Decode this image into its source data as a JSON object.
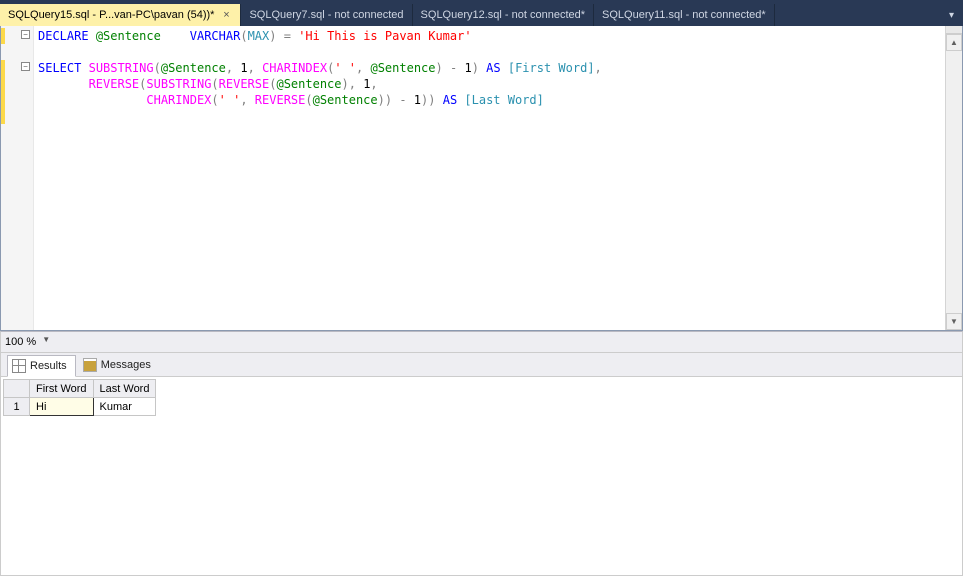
{
  "tabs": [
    {
      "label": "SQLQuery15.sql - P...van-PC\\pavan (54))*",
      "active": true,
      "closeable": true
    },
    {
      "label": "SQLQuery7.sql - not connected",
      "active": false,
      "closeable": false
    },
    {
      "label": "SQLQuery12.sql - not connected*",
      "active": false,
      "closeable": false
    },
    {
      "label": "SQLQuery11.sql - not connected*",
      "active": false,
      "closeable": false
    }
  ],
  "zoom": {
    "value": "100 %"
  },
  "code": {
    "l1": {
      "declare": "DECLARE",
      "var": "@Sentence",
      "type_kw": "VARCHAR",
      "type_arg": "MAX",
      "eq": "=",
      "str": "'Hi This is Pavan Kumar'"
    },
    "l3": {
      "select": "SELECT",
      "sub": "SUBSTRING",
      "var": "@Sentence",
      "c1": "1",
      "chi": "CHARINDEX",
      "sp": "' '",
      "var2": "@Sentence",
      "minus1": "1",
      "as": "AS",
      "alias": "[First Word]"
    },
    "l4": {
      "rev": "REVERSE",
      "sub": "SUBSTRING",
      "rev2": "REVERSE",
      "var": "@Sentence",
      "c1": "1"
    },
    "l5": {
      "chi": "CHARINDEX",
      "sp": "' '",
      "rev": "REVERSE",
      "var": "@Sentence",
      "minus1": "1",
      "as": "AS",
      "alias": "[Last Word]"
    }
  },
  "results_tabs": {
    "results": "Results",
    "messages": "Messages"
  },
  "grid": {
    "headers": {
      "rownum": "",
      "c1": "First Word",
      "c2": "Last Word"
    },
    "rows": [
      {
        "n": "1",
        "c1": "Hi",
        "c2": "Kumar"
      }
    ]
  }
}
